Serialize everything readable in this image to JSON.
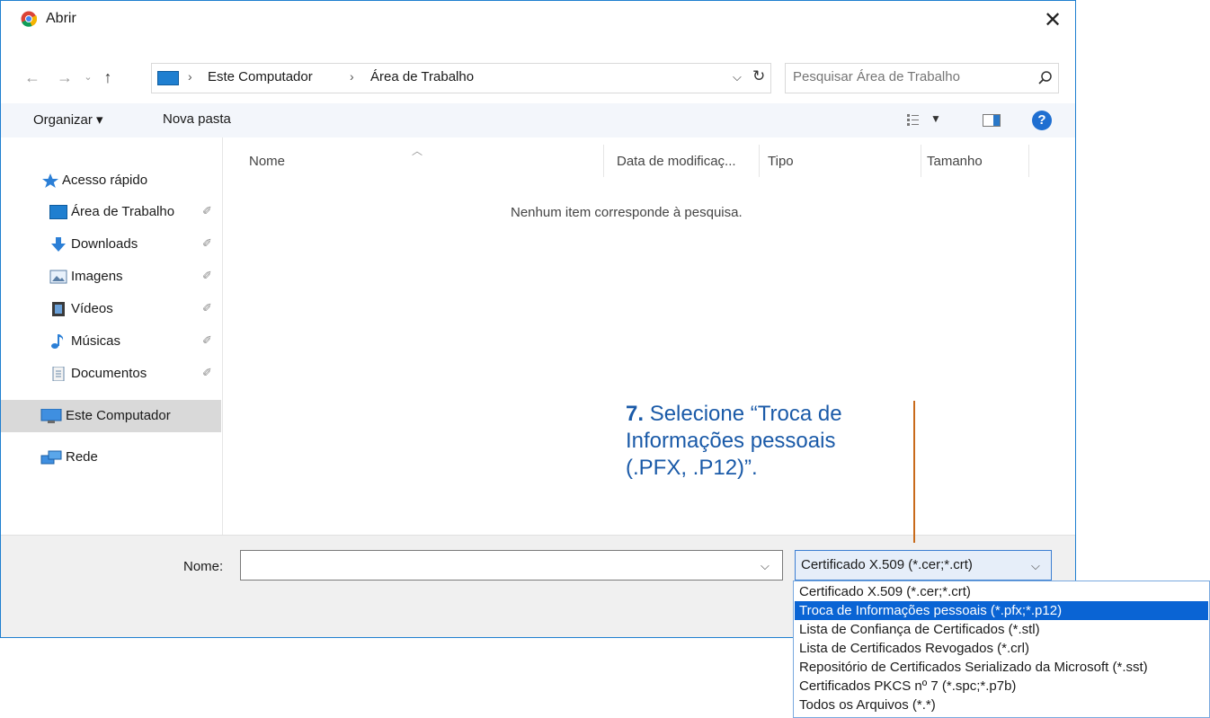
{
  "window": {
    "title": "Abrir"
  },
  "address": {
    "crumbs": [
      "Este Computador",
      "Área de Trabalho"
    ],
    "separator": "›"
  },
  "search": {
    "placeholder": "Pesquisar Área de Trabalho"
  },
  "toolbar": {
    "organize_label": "Organizar ▾",
    "new_folder_label": "Nova pasta",
    "help_label": "?"
  },
  "sidebar": {
    "items": [
      {
        "label": "Acesso rápido",
        "icon": "star-icon",
        "pinned": false
      },
      {
        "label": "Área de Trabalho",
        "icon": "desktop-icon",
        "pinned": true
      },
      {
        "label": "Downloads",
        "icon": "download-icon",
        "pinned": true
      },
      {
        "label": "Imagens",
        "icon": "pictures-icon",
        "pinned": true
      },
      {
        "label": "Vídeos",
        "icon": "videos-icon",
        "pinned": true
      },
      {
        "label": "Músicas",
        "icon": "music-icon",
        "pinned": true
      },
      {
        "label": "Documentos",
        "icon": "documents-icon",
        "pinned": true
      },
      {
        "label": "Este Computador",
        "icon": "computer-icon",
        "pinned": false,
        "selected": true
      },
      {
        "label": "Rede",
        "icon": "network-icon",
        "pinned": false
      }
    ],
    "pin_glyph": "✐"
  },
  "columns": [
    "Nome",
    "Data de modificaç...",
    "Tipo",
    "Tamanho"
  ],
  "empty_message": "Nenhum item corresponde à pesquisa.",
  "bottom": {
    "name_label": "Nome:",
    "name_value": "",
    "filetype_selected": "Certificado X.509 (*.cer;*.crt)",
    "filetype_options": [
      "Certificado X.509 (*.cer;*.crt)",
      "Troca de Informações pessoais (*.pfx;*.p12)",
      "Lista de Confiança de Certificados (*.stl)",
      "Lista de Certificados Revogados (*.crl)",
      "Repositório de Certificados Serializado da Microsoft (*.sst)",
      "Certificados PKCS nº 7 (*.spc;*.p7b)",
      "Todos os Arquivos (*.*)"
    ],
    "highlighted_option_index": 1
  },
  "annotation": {
    "step": "7.",
    "text": "Selecione “Troca de Informações pessoais (.PFX, .P12)”."
  },
  "colors": {
    "accent": "#1f7fd0",
    "selection": "#0a64d4",
    "annotation_text": "#1a5aa8",
    "annotation_line": "#c86a1a"
  }
}
